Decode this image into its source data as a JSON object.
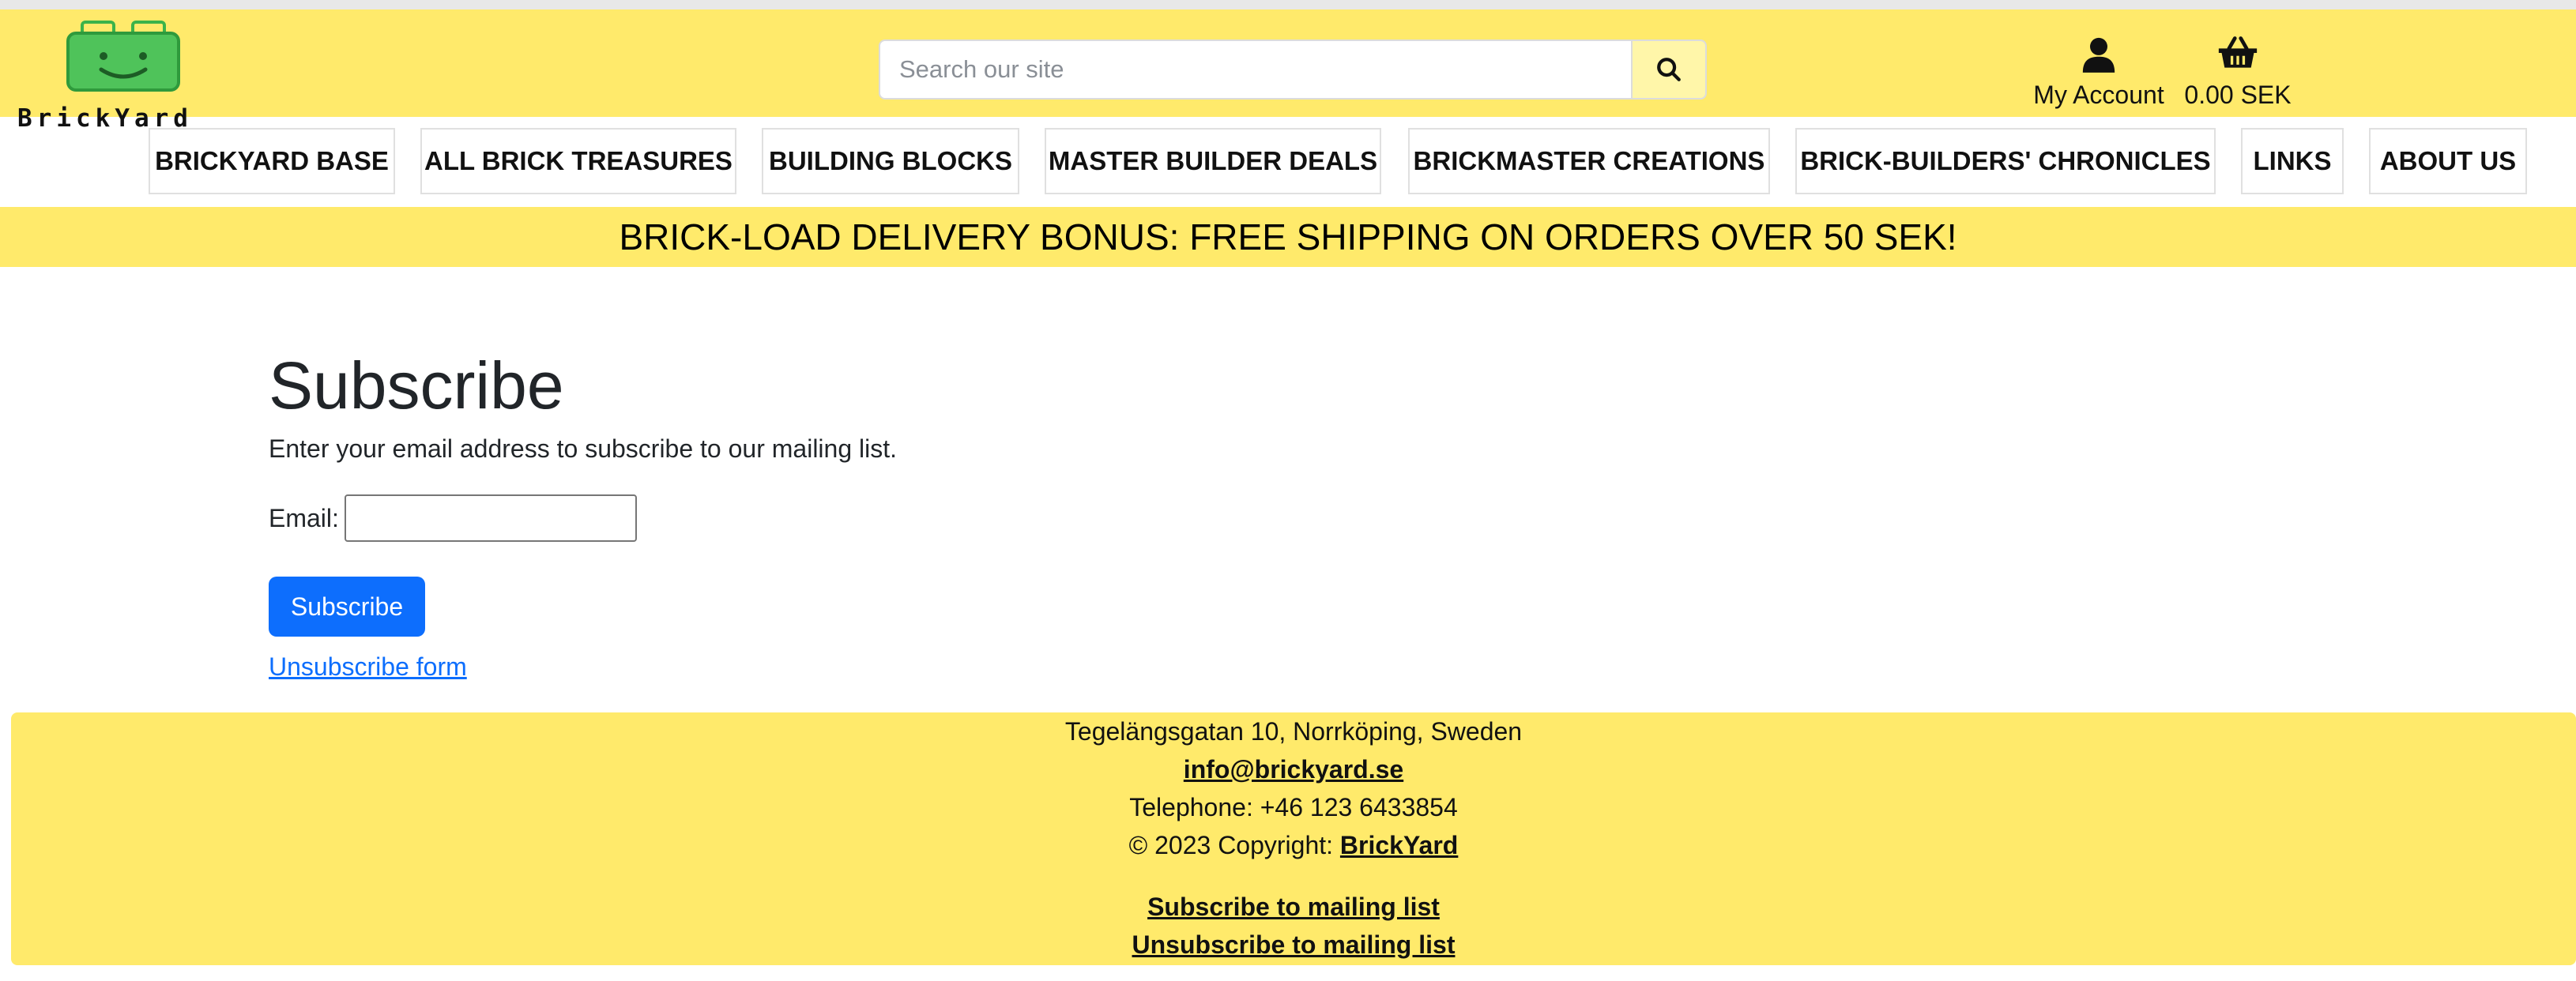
{
  "logo": {
    "text": "BrickYard"
  },
  "search": {
    "placeholder": "Search our site"
  },
  "header": {
    "account_label": "My Account",
    "cart_total": "0.00 SEK"
  },
  "nav": {
    "items": [
      {
        "label": "BRICKYARD BASE"
      },
      {
        "label": "ALL BRICK TREASURES"
      },
      {
        "label": "BUILDING BLOCKS"
      },
      {
        "label": "MASTER BUILDER DEALS"
      },
      {
        "label": "BRICKMASTER CREATIONS"
      },
      {
        "label": "BRICK-BUILDERS' CHRONICLES"
      },
      {
        "label": "LINKS"
      },
      {
        "label": "ABOUT US"
      }
    ]
  },
  "banner": {
    "text": "BRICK-LOAD DELIVERY BONUS: FREE SHIPPING ON ORDERS OVER 50 SEK!"
  },
  "main": {
    "title": "Subscribe",
    "description": "Enter your email address to subscribe to our mailing list.",
    "email_label": "Email:",
    "email_value": "",
    "subscribe_button": "Subscribe",
    "unsubscribe_link": "Unsubscribe form"
  },
  "footer": {
    "address": "Tegelängsgatan 10, Norrköping, Sweden",
    "email": "info@brickyard.se",
    "telephone": "Telephone: +46 123 6433854",
    "copyright_prefix": "© 2023 Copyright:",
    "copyright_link": "BrickYard",
    "subscribe_link": "Subscribe to mailing list",
    "unsubscribe_link": "Unsubscribe to mailing list"
  },
  "colors": {
    "accent_yellow": "#ffea6b",
    "primary_blue": "#0d6efd",
    "logo_green": "#3bb34a"
  },
  "icons": {
    "search": "search-icon",
    "account": "user-icon",
    "cart": "basket-icon"
  }
}
